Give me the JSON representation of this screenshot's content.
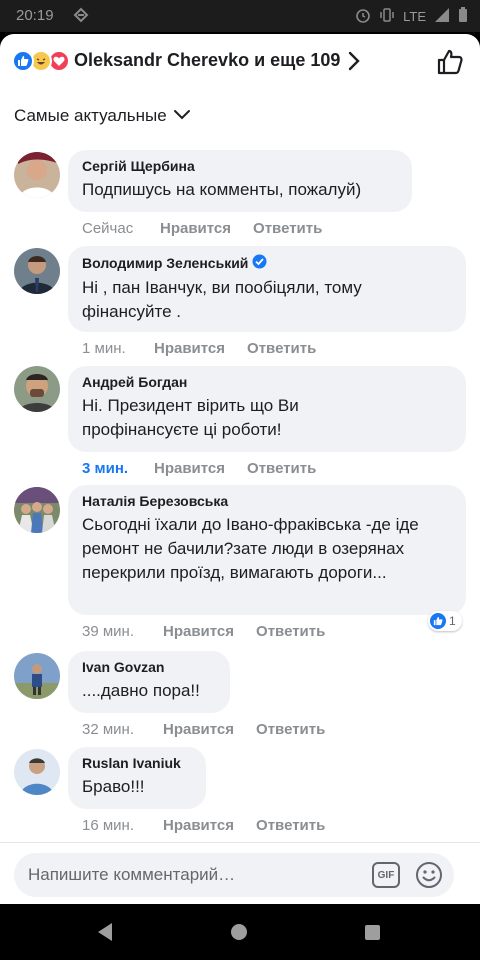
{
  "status_bar": {
    "time": "20:19",
    "network": "LTE",
    "icons": [
      "notification-icon",
      "alarm-icon",
      "vibrate-icon",
      "signal-icon",
      "battery-icon"
    ]
  },
  "header": {
    "title": "Oleksandr Cherevko и еще 109",
    "reactions": [
      "like",
      "haha",
      "love"
    ]
  },
  "sort": {
    "label": "Самые актуальные"
  },
  "colors": {
    "accent": "#1877f2",
    "bubble": "#f0f2f5",
    "meta": "#8a8d91"
  },
  "comments": [
    {
      "author": "Сергій Щербина",
      "verified": false,
      "text": "Подпишусь на комменты, пожалуй)",
      "time": "Сейчас",
      "like": "Нравится",
      "reply": "Ответить"
    },
    {
      "author": "Володимир Зеленський",
      "verified": true,
      "text": "Ні , пан Іванчук, ви пообіцяли, тому фінансуйте .",
      "time": "1 мин.",
      "like": "Нравится",
      "reply": "Ответить"
    },
    {
      "author": "Андрей Богдан",
      "verified": false,
      "text": "Ні. Президент вірить що Ви профінансуєте ці роботи!",
      "time": "3 мин.",
      "like": "Нравится",
      "reply": "Ответить"
    },
    {
      "author": "Наталія Березовська",
      "verified": false,
      "text": "Сьогодні їхали до Івано-фраківська -де іде ремонт не бачили?зате люди в озерянах перекрили проїзд, вимагають дороги...",
      "time": "39 мин.",
      "like": "Нравится",
      "reply": "Ответить",
      "reaction_count": "1"
    },
    {
      "author": "Ivan Govzan",
      "verified": false,
      "text": "....давно пора!!",
      "time": "32 мин.",
      "like": "Нравится",
      "reply": "Ответить"
    },
    {
      "author": "Ruslan Ivaniuk",
      "verified": false,
      "text": "Браво!!!",
      "time": "16 мин.",
      "like": "Нравится",
      "reply": "Ответить"
    }
  ],
  "composer": {
    "placeholder": "Напишите комментарий…",
    "gif_label": "GIF"
  }
}
